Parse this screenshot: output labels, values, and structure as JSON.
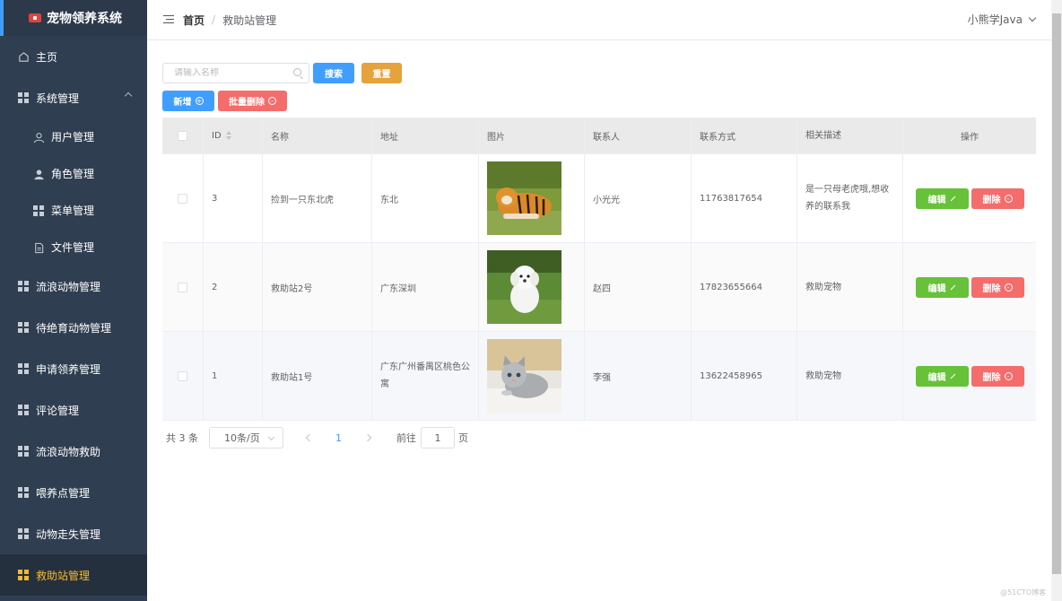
{
  "app": {
    "title": "宠物领养系统"
  },
  "sidebar": {
    "items": [
      {
        "label": "主页"
      },
      {
        "label": "系统管理"
      },
      {
        "label": "用户管理"
      },
      {
        "label": "角色管理"
      },
      {
        "label": "菜单管理"
      },
      {
        "label": "文件管理"
      },
      {
        "label": "流浪动物管理"
      },
      {
        "label": "待绝育动物管理"
      },
      {
        "label": "申请领养管理"
      },
      {
        "label": "评论管理"
      },
      {
        "label": "流浪动物救助"
      },
      {
        "label": "喂养点管理"
      },
      {
        "label": "动物走失管理"
      },
      {
        "label": "救助站管理"
      }
    ]
  },
  "header": {
    "breadcrumb_home": "首页",
    "breadcrumb_sep": "/",
    "breadcrumb_current": "救助站管理",
    "user": "小熊学Java"
  },
  "toolbar": {
    "search_placeholder": "请输入名称",
    "search_label": "搜索",
    "reset_label": "重置",
    "add_label": "新增",
    "batch_delete_label": "批量删除"
  },
  "table": {
    "columns": [
      "ID",
      "名称",
      "地址",
      "图片",
      "联系人",
      "联系方式",
      "相关描述",
      "操作"
    ],
    "rows": [
      {
        "id": "3",
        "name": "捡到一只东北虎",
        "address": "东北",
        "image": "tiger",
        "contact": "小光光",
        "phone": "11763817654",
        "desc": "是一只母老虎哦,想收养的联系我"
      },
      {
        "id": "2",
        "name": "救助站2号",
        "address": "广东深圳",
        "image": "white-dog",
        "contact": "赵四",
        "phone": "17823655664",
        "desc": "救助宠物"
      },
      {
        "id": "1",
        "name": "救助站1号",
        "address": "广东广州番禺区桃色公寓",
        "image": "grey-kitten",
        "contact": "李强",
        "phone": "13622458965",
        "desc": "救助宠物"
      }
    ],
    "edit_label": "编辑",
    "delete_label": "删除"
  },
  "pagination": {
    "total": "共 3 条",
    "page_size": "10条/页",
    "current": "1",
    "goto": "前往",
    "goto_value": "1",
    "unit": "页"
  },
  "watermark": "@51CTO博客"
}
